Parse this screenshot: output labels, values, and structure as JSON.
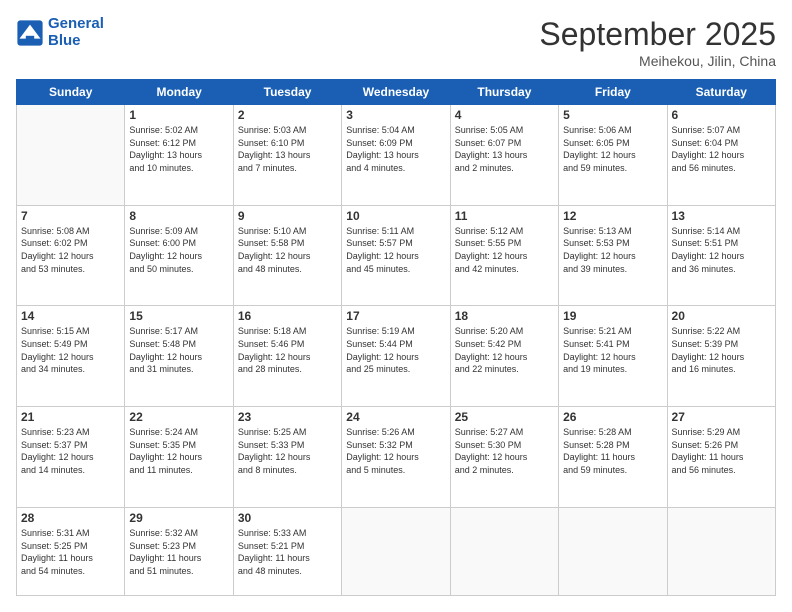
{
  "header": {
    "logo_line1": "General",
    "logo_line2": "Blue",
    "month": "September 2025",
    "location": "Meihekou, Jilin, China"
  },
  "weekdays": [
    "Sunday",
    "Monday",
    "Tuesday",
    "Wednesday",
    "Thursday",
    "Friday",
    "Saturday"
  ],
  "weeks": [
    [
      {
        "day": "",
        "info": ""
      },
      {
        "day": "1",
        "info": "Sunrise: 5:02 AM\nSunset: 6:12 PM\nDaylight: 13 hours\nand 10 minutes."
      },
      {
        "day": "2",
        "info": "Sunrise: 5:03 AM\nSunset: 6:10 PM\nDaylight: 13 hours\nand 7 minutes."
      },
      {
        "day": "3",
        "info": "Sunrise: 5:04 AM\nSunset: 6:09 PM\nDaylight: 13 hours\nand 4 minutes."
      },
      {
        "day": "4",
        "info": "Sunrise: 5:05 AM\nSunset: 6:07 PM\nDaylight: 13 hours\nand 2 minutes."
      },
      {
        "day": "5",
        "info": "Sunrise: 5:06 AM\nSunset: 6:05 PM\nDaylight: 12 hours\nand 59 minutes."
      },
      {
        "day": "6",
        "info": "Sunrise: 5:07 AM\nSunset: 6:04 PM\nDaylight: 12 hours\nand 56 minutes."
      }
    ],
    [
      {
        "day": "7",
        "info": "Sunrise: 5:08 AM\nSunset: 6:02 PM\nDaylight: 12 hours\nand 53 minutes."
      },
      {
        "day": "8",
        "info": "Sunrise: 5:09 AM\nSunset: 6:00 PM\nDaylight: 12 hours\nand 50 minutes."
      },
      {
        "day": "9",
        "info": "Sunrise: 5:10 AM\nSunset: 5:58 PM\nDaylight: 12 hours\nand 48 minutes."
      },
      {
        "day": "10",
        "info": "Sunrise: 5:11 AM\nSunset: 5:57 PM\nDaylight: 12 hours\nand 45 minutes."
      },
      {
        "day": "11",
        "info": "Sunrise: 5:12 AM\nSunset: 5:55 PM\nDaylight: 12 hours\nand 42 minutes."
      },
      {
        "day": "12",
        "info": "Sunrise: 5:13 AM\nSunset: 5:53 PM\nDaylight: 12 hours\nand 39 minutes."
      },
      {
        "day": "13",
        "info": "Sunrise: 5:14 AM\nSunset: 5:51 PM\nDaylight: 12 hours\nand 36 minutes."
      }
    ],
    [
      {
        "day": "14",
        "info": "Sunrise: 5:15 AM\nSunset: 5:49 PM\nDaylight: 12 hours\nand 34 minutes."
      },
      {
        "day": "15",
        "info": "Sunrise: 5:17 AM\nSunset: 5:48 PM\nDaylight: 12 hours\nand 31 minutes."
      },
      {
        "day": "16",
        "info": "Sunrise: 5:18 AM\nSunset: 5:46 PM\nDaylight: 12 hours\nand 28 minutes."
      },
      {
        "day": "17",
        "info": "Sunrise: 5:19 AM\nSunset: 5:44 PM\nDaylight: 12 hours\nand 25 minutes."
      },
      {
        "day": "18",
        "info": "Sunrise: 5:20 AM\nSunset: 5:42 PM\nDaylight: 12 hours\nand 22 minutes."
      },
      {
        "day": "19",
        "info": "Sunrise: 5:21 AM\nSunset: 5:41 PM\nDaylight: 12 hours\nand 19 minutes."
      },
      {
        "day": "20",
        "info": "Sunrise: 5:22 AM\nSunset: 5:39 PM\nDaylight: 12 hours\nand 16 minutes."
      }
    ],
    [
      {
        "day": "21",
        "info": "Sunrise: 5:23 AM\nSunset: 5:37 PM\nDaylight: 12 hours\nand 14 minutes."
      },
      {
        "day": "22",
        "info": "Sunrise: 5:24 AM\nSunset: 5:35 PM\nDaylight: 12 hours\nand 11 minutes."
      },
      {
        "day": "23",
        "info": "Sunrise: 5:25 AM\nSunset: 5:33 PM\nDaylight: 12 hours\nand 8 minutes."
      },
      {
        "day": "24",
        "info": "Sunrise: 5:26 AM\nSunset: 5:32 PM\nDaylight: 12 hours\nand 5 minutes."
      },
      {
        "day": "25",
        "info": "Sunrise: 5:27 AM\nSunset: 5:30 PM\nDaylight: 12 hours\nand 2 minutes."
      },
      {
        "day": "26",
        "info": "Sunrise: 5:28 AM\nSunset: 5:28 PM\nDaylight: 11 hours\nand 59 minutes."
      },
      {
        "day": "27",
        "info": "Sunrise: 5:29 AM\nSunset: 5:26 PM\nDaylight: 11 hours\nand 56 minutes."
      }
    ],
    [
      {
        "day": "28",
        "info": "Sunrise: 5:31 AM\nSunset: 5:25 PM\nDaylight: 11 hours\nand 54 minutes."
      },
      {
        "day": "29",
        "info": "Sunrise: 5:32 AM\nSunset: 5:23 PM\nDaylight: 11 hours\nand 51 minutes."
      },
      {
        "day": "30",
        "info": "Sunrise: 5:33 AM\nSunset: 5:21 PM\nDaylight: 11 hours\nand 48 minutes."
      },
      {
        "day": "",
        "info": ""
      },
      {
        "day": "",
        "info": ""
      },
      {
        "day": "",
        "info": ""
      },
      {
        "day": "",
        "info": ""
      }
    ]
  ]
}
